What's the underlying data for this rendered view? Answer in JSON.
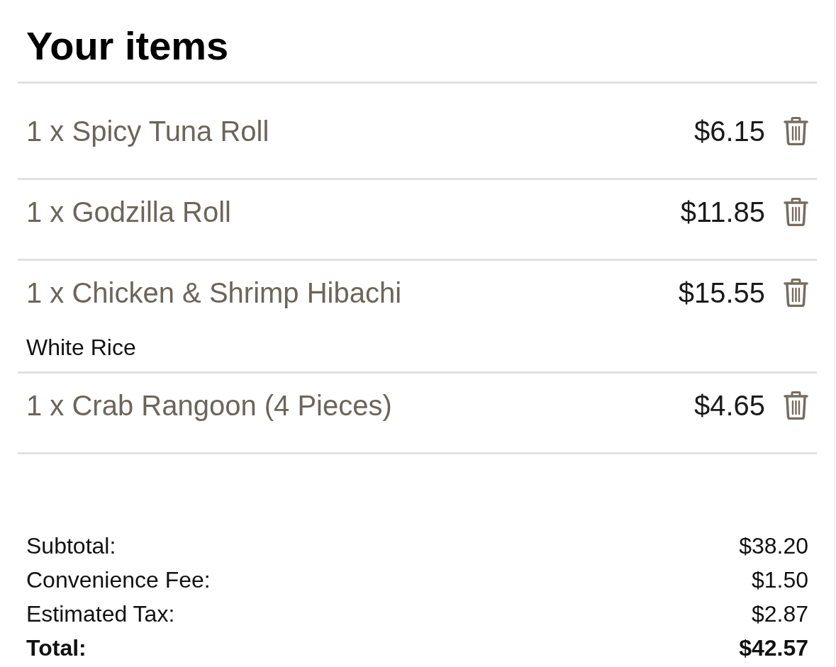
{
  "title": "Your items",
  "items": [
    {
      "name": "1 x Spicy Tuna Roll",
      "price": "$6.15"
    },
    {
      "name": "1 x Godzilla Roll",
      "price": "$11.85"
    },
    {
      "name": "1 x Chicken & Shrimp Hibachi",
      "price": "$15.55",
      "modifiers": [
        "White Rice"
      ]
    },
    {
      "name": "1 x Crab Rangoon (4 Pieces)",
      "price": "$4.65"
    }
  ],
  "summary": [
    {
      "kind": "line",
      "label": "Subtotal:",
      "value": "$38.20"
    },
    {
      "kind": "line",
      "label": "Convenience Fee:",
      "value": "$1.50"
    },
    {
      "kind": "line",
      "label": "Estimated Tax:",
      "value": "$2.87"
    },
    {
      "kind": "total",
      "label": "Total:",
      "value": "$42.57"
    }
  ]
}
